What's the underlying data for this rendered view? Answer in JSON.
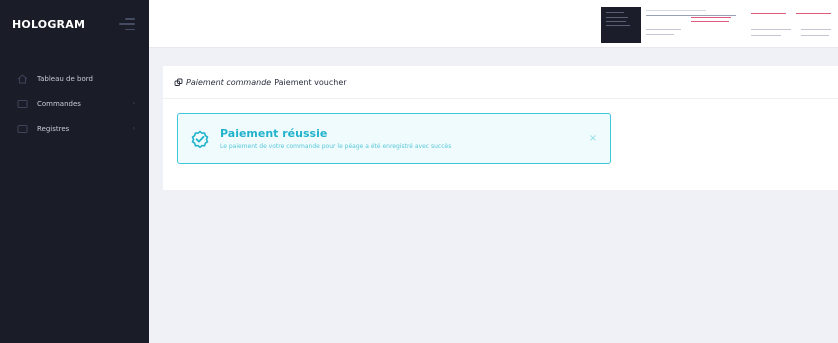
{
  "sidebar": {
    "brand": "HOLOGRAM",
    "items": [
      {
        "label": "Tableau de bord",
        "icon": "home-icon",
        "has_submenu": false
      },
      {
        "label": "Commandes",
        "icon": "orders-icon",
        "has_submenu": true
      },
      {
        "label": "Registres",
        "icon": "registers-icon",
        "has_submenu": true
      }
    ],
    "chevron": "›"
  },
  "breadcrumb": {
    "section": "Paiement commande",
    "current": "Paiement voucher"
  },
  "alert": {
    "title": "Paiement réussie",
    "message": "Le paiement de votre commande pour le péage a été enregistré avec succès",
    "close": "×",
    "icon": "check-badge-icon"
  },
  "colors": {
    "sidebar_bg": "#1a1c28",
    "accent": "#22b3cc",
    "alert_border": "#3fc6d8",
    "page_bg": "#f0f1f6"
  }
}
